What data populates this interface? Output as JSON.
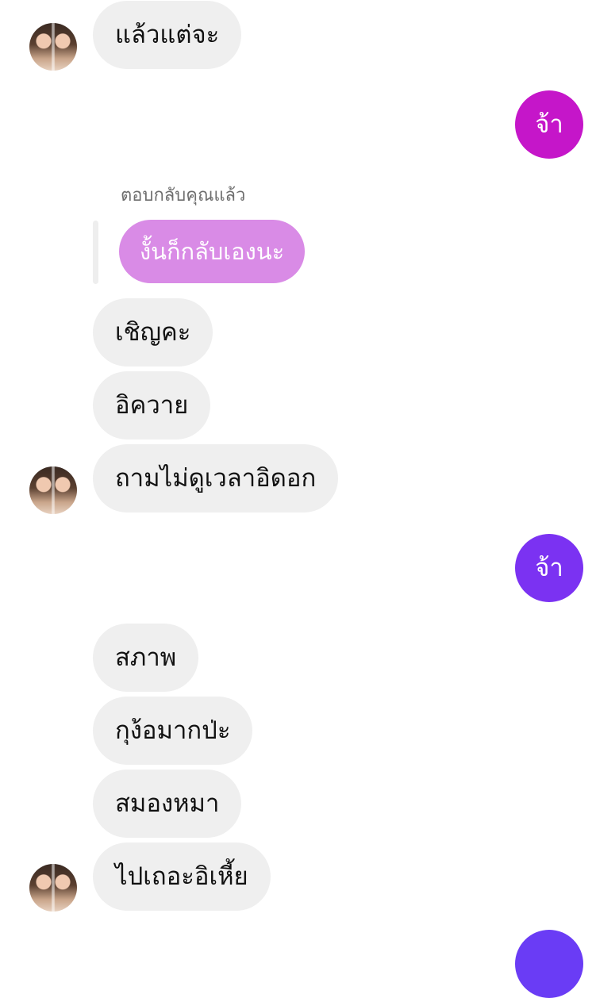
{
  "messages": [
    {
      "text": "แล้วแต่จะ"
    },
    {
      "text": "จ้า"
    },
    {
      "text": "เชิญคะ"
    },
    {
      "text": "อิควาย"
    },
    {
      "text": "ถามไม่ดูเวลาอิดอก"
    },
    {
      "text": "จ้า"
    },
    {
      "text": "สภาพ"
    },
    {
      "text": "กุง้อมากป่ะ"
    },
    {
      "text": "สมองหมา"
    },
    {
      "text": "ไปเถอะอิเหี้ย"
    }
  ],
  "reply": {
    "label": "ตอบกลับคุณแล้ว",
    "quoted_text": "งั้นก็กลับเองนะ"
  },
  "colors": {
    "incoming_bubble": "#efefef",
    "outgoing_bubble_1": "#c516c9",
    "outgoing_bubble_2": "#7b32f2",
    "outgoing_bubble_3": "#6a3cf5",
    "reply_bubble": "#d98be6"
  }
}
